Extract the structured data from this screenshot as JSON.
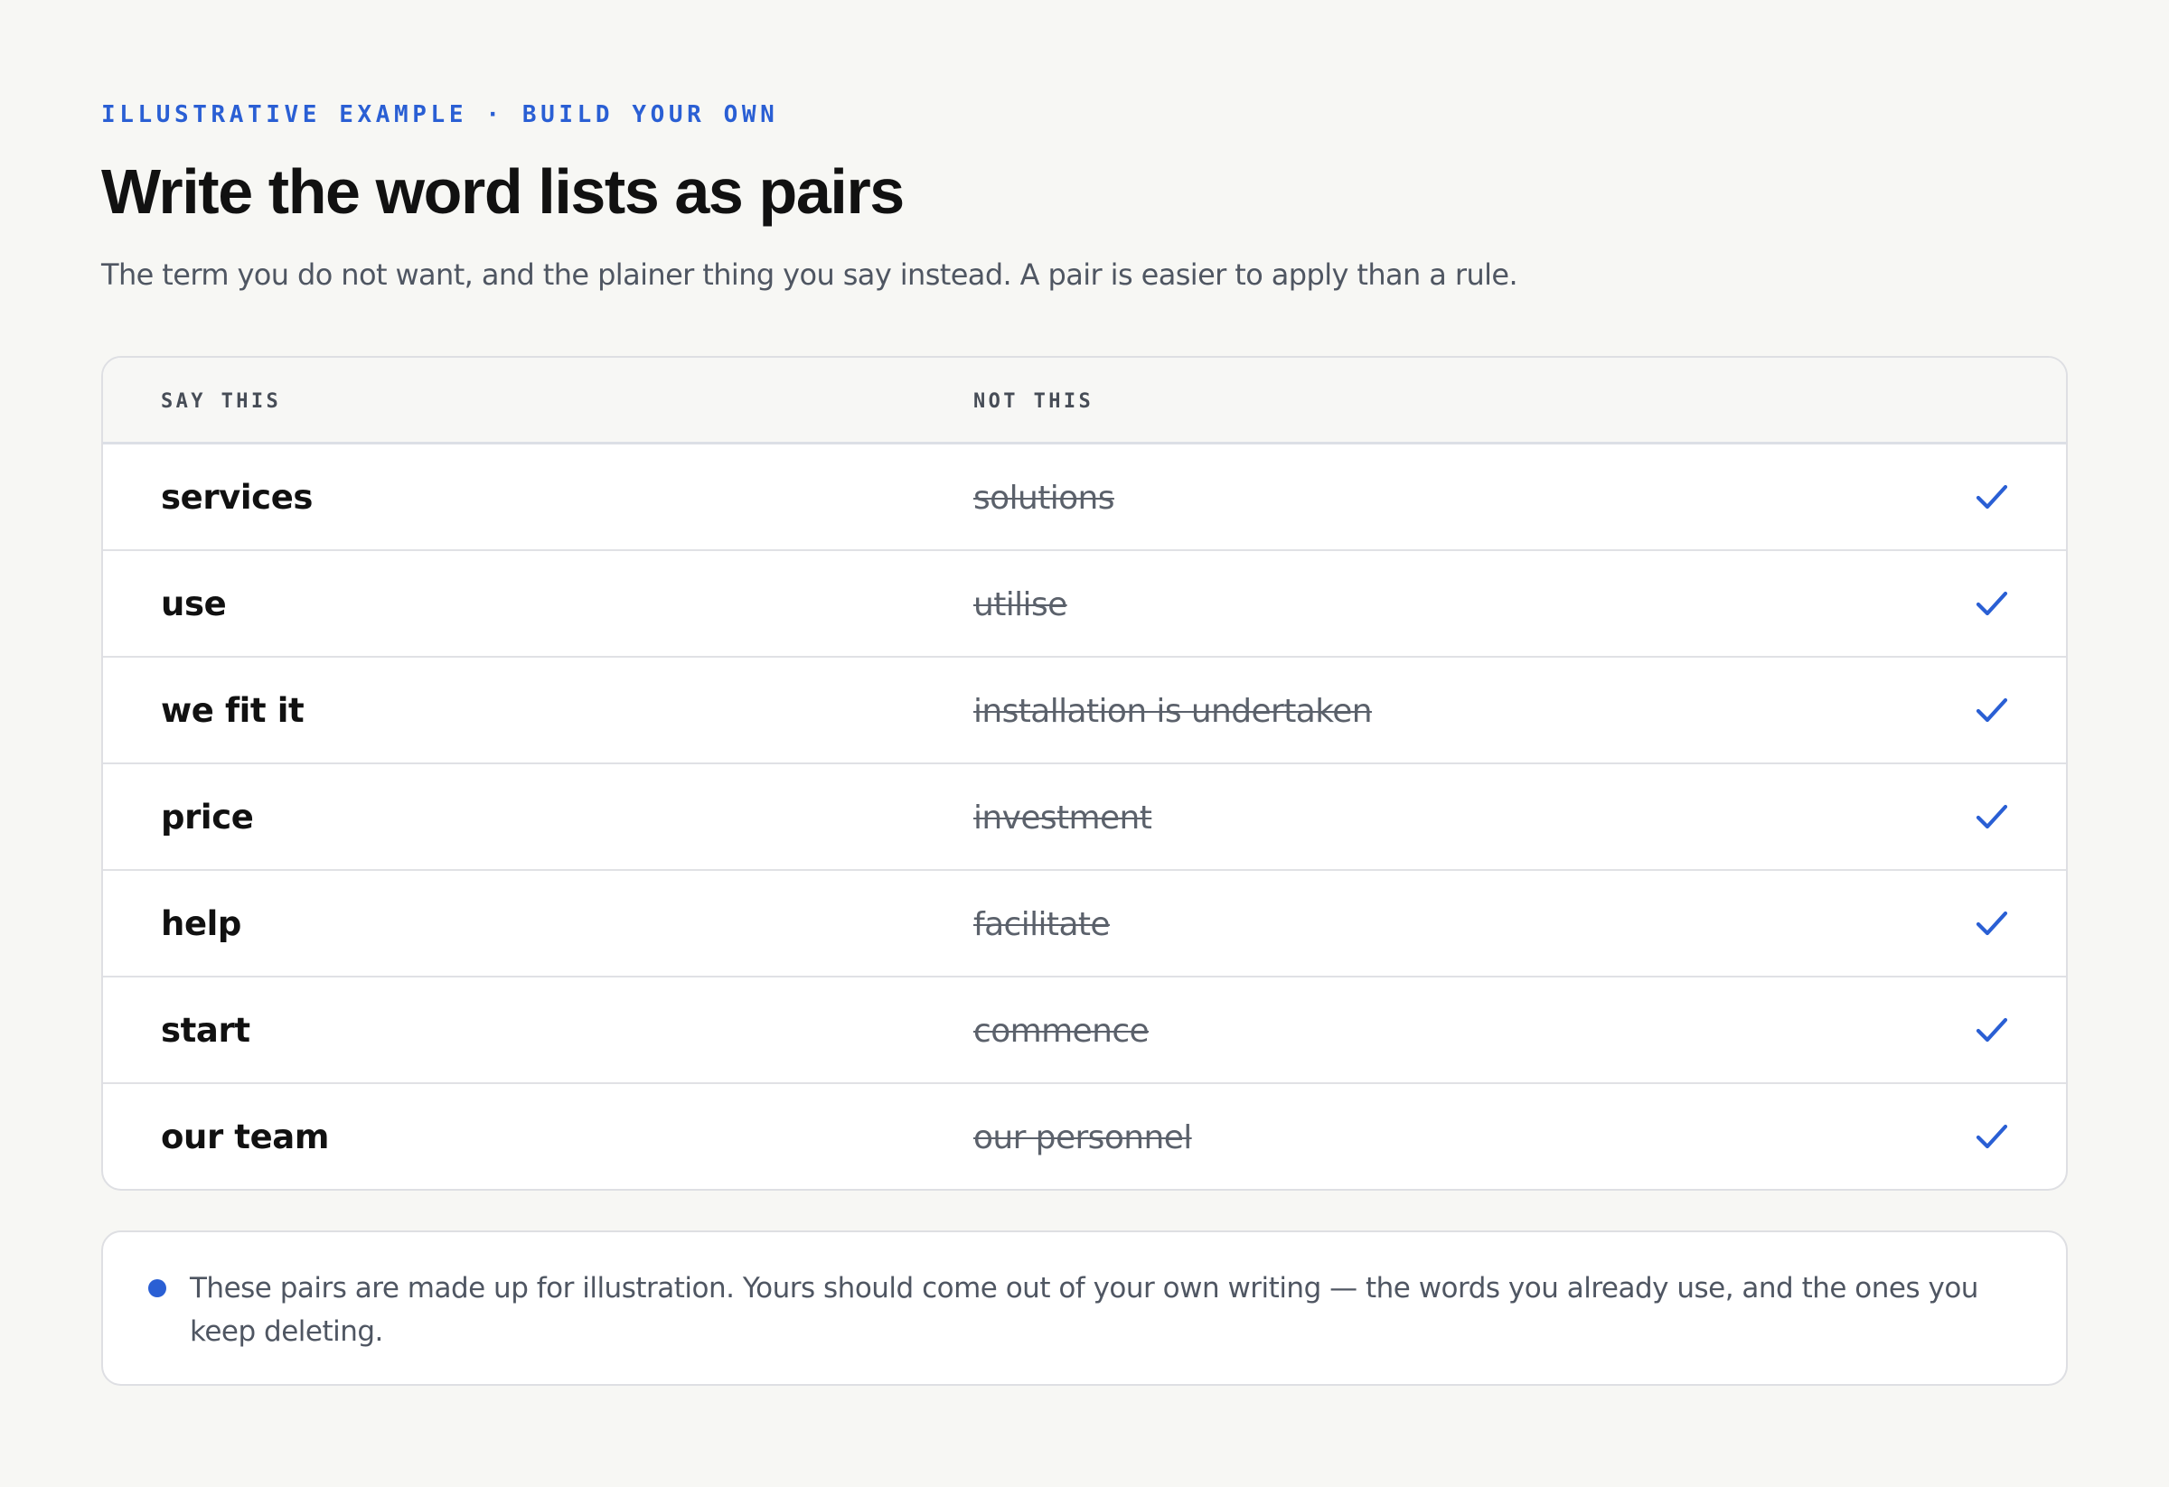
{
  "header": {
    "eyebrow": "ILLUSTRATIVE EXAMPLE · BUILD YOUR OWN",
    "title": "Write the word lists as pairs",
    "subtitle": "The term you do not want, and the plainer thing you say instead. A pair is easier to apply than a rule."
  },
  "table": {
    "col_say": "SAY THIS",
    "col_not": "NOT THIS",
    "rows": [
      {
        "say": "services",
        "not": "solutions",
        "icon": "check-icon"
      },
      {
        "say": "use",
        "not": "utilise",
        "icon": "check-icon"
      },
      {
        "say": "we fit it",
        "not": "installation is undertaken",
        "icon": "check-icon"
      },
      {
        "say": "price",
        "not": "investment",
        "icon": "check-icon"
      },
      {
        "say": "help",
        "not": "facilitate",
        "icon": "check-icon"
      },
      {
        "say": "start",
        "not": "commence",
        "icon": "check-icon"
      },
      {
        "say": "our team",
        "not": "our personnel",
        "icon": "check-icon"
      }
    ]
  },
  "note": {
    "bullet_icon": "bullet-dot-icon",
    "text": "These pairs are made up for illustration. Yours should come out of your own writing — the words you already use, and the ones you keep deleting."
  },
  "colors": {
    "accent": "#2a5fd4",
    "background": "#f7f7f4",
    "card": "#ffffff",
    "muted_text": "#4f5662"
  }
}
